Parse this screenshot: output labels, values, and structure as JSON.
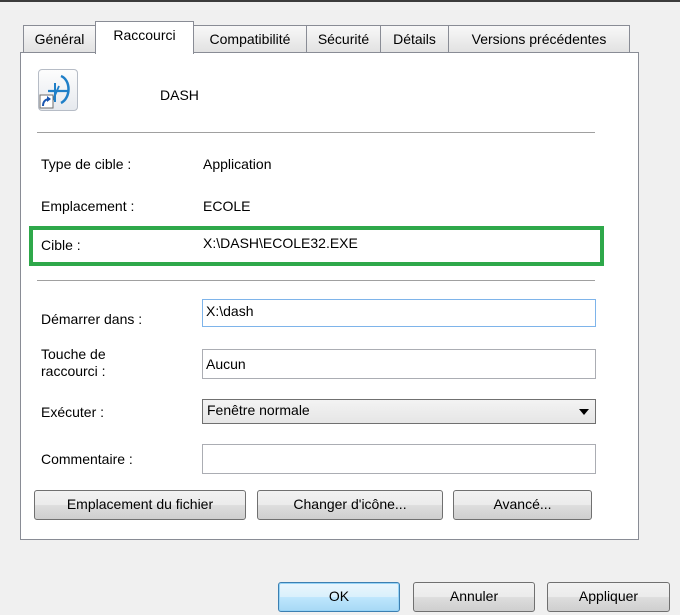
{
  "tabs": [
    {
      "label": "Général"
    },
    {
      "label": "Raccourci"
    },
    {
      "label": "Compatibilité"
    },
    {
      "label": "Sécurité"
    },
    {
      "label": "Détails"
    },
    {
      "label": "Versions précédentes"
    }
  ],
  "active_tab": "Raccourci",
  "header": {
    "name": "DASH"
  },
  "properties": {
    "target_type_label": "Type de cible :",
    "target_type_value": "Application",
    "location_label": "Emplacement :",
    "location_value": "ECOLE",
    "target_label": "Cible :",
    "target_value": "X:\\DASH\\ECOLE32.EXE",
    "start_in_label": "Démarrer dans :",
    "start_in_value": "X:\\dash",
    "shortcut_key_label": "Touche de raccourci :",
    "shortcut_key_value": "Aucun",
    "run_label": "Exécuter :",
    "run_value": "Fenêtre normale",
    "comment_label": "Commentaire :",
    "comment_value": ""
  },
  "buttons": {
    "open_location": "Emplacement du fichier",
    "change_icon": "Changer d'icône...",
    "advanced": "Avancé...",
    "ok": "OK",
    "cancel": "Annuler",
    "apply": "Appliquer"
  },
  "colors": {
    "highlight": "#2ea84a",
    "tab_border": "#898c95",
    "focus_border": "#7eb4ea"
  }
}
